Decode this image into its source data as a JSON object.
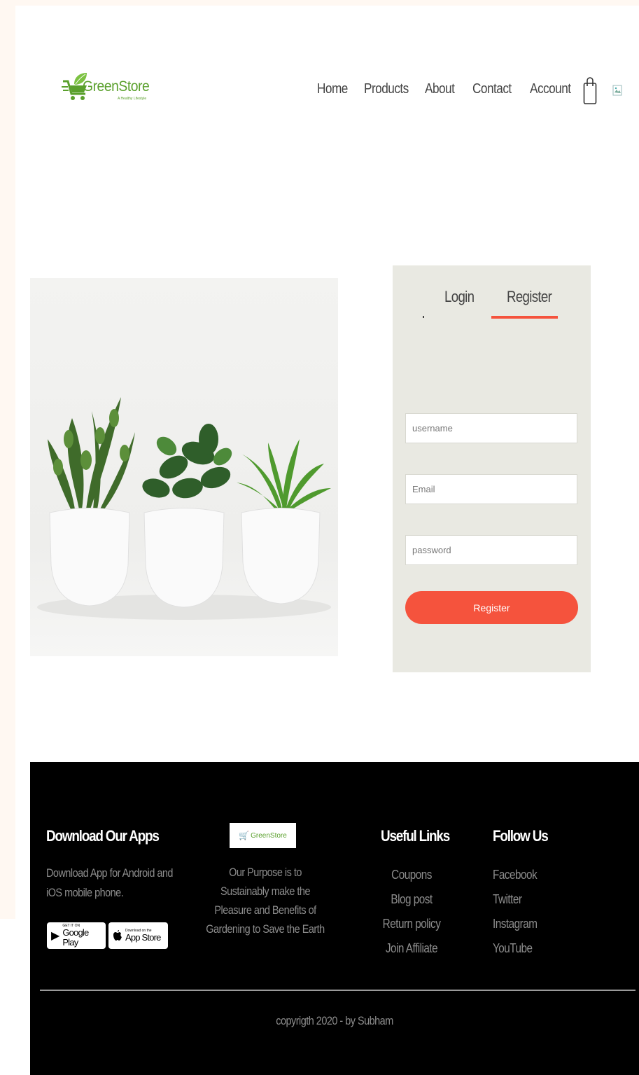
{
  "header": {
    "logo_text": "GreenStore",
    "logo_tagline": "A Healthy Lifestyle",
    "nav": [
      "Home",
      "Products",
      "About",
      "Contact",
      "Account"
    ]
  },
  "auth": {
    "tabs": [
      "Login",
      "Register"
    ],
    "active_tab": "Register",
    "username_placeholder": "username",
    "email_placeholder": "Email",
    "password_placeholder": "password",
    "submit_label": "Register"
  },
  "footer": {
    "apps_heading": "Download Our Apps",
    "apps_text": "Download App for Android and iOS mobile phone.",
    "google_small": "GET IT ON",
    "google_big": "Google Play",
    "apple_small": "Download on the",
    "apple_big": "App Store",
    "mid_logo_text": "GreenStore",
    "purpose_text": "Our Purpose is to Sustainably make the Pleasure and Benefits of Gardening to Save the Earth",
    "links_heading": "Useful Links",
    "links": [
      "Coupons",
      "Blog post",
      "Return policy",
      "Join Affiliate"
    ],
    "follow_heading": "Follow Us",
    "follow": [
      "Facebook",
      "Twitter",
      "Instagram",
      "YouTube"
    ],
    "copyright": "copyrigth 2020 - by Subham"
  },
  "colors": {
    "accent": "#f5533d",
    "brand_green": "#5aa02c",
    "card_bg": "#e9e9e2",
    "footer_bg": "#000000"
  }
}
